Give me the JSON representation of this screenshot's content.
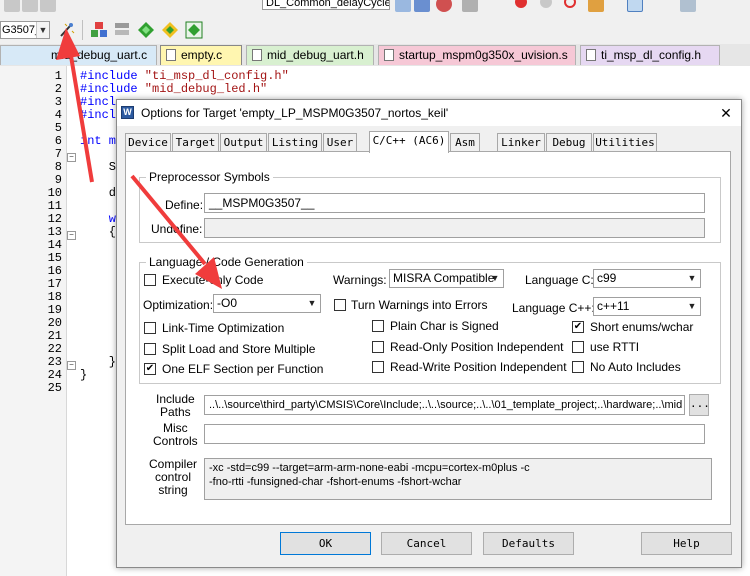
{
  "toolbar": {
    "target_combo_value": "G3507_",
    "function_combo_value": "DL_Common_delayCycles"
  },
  "file_tabs": [
    {
      "label": "mid_debug_uart.c",
      "color": "#d7e9f7"
    },
    {
      "label": "empty.c",
      "color": "#fff6b0"
    },
    {
      "label": "mid_debug_uart.h",
      "color": "#d8f0d0"
    },
    {
      "label": "startup_mspm0g350x_uvision.s",
      "color": "#f6c8d6"
    },
    {
      "label": "ti_msp_dl_config.h",
      "color": "#e6d8f2"
    }
  ],
  "editor": {
    "line_numbers": [
      "1",
      "2",
      "3",
      "4",
      "5",
      "6",
      "7",
      "8",
      "9",
      "10",
      "11",
      "12",
      "13",
      "14",
      "15",
      "16",
      "17",
      "18",
      "19",
      "20",
      "21",
      "22",
      "23",
      "24",
      "25"
    ],
    "code_lines": {
      "l1_kw": "#include",
      "l1_str": " \"ti_msp_dl_config.h\"",
      "l2_kw": "#include",
      "l2_str": " \"mid_debug_led.h\"",
      "l3": "#incl",
      "l4": "#incl",
      "l6": "int m",
      "l8": "    Sy",
      "l10": "    d",
      "l12": "    w",
      "l13": "    {",
      "l21": "    }",
      "l22": "}"
    }
  },
  "dialog": {
    "title": "Options for Target 'empty_LP_MSPM0G3507_nortos_keil'",
    "close_label": "✕",
    "tabs": [
      "Device",
      "Target",
      "Output",
      "Listing",
      "User",
      "C/C++ (AC6)",
      "Asm",
      "Linker",
      "Debug",
      "Utilities"
    ],
    "active_tab": "C/C++ (AC6)",
    "preprocessor": {
      "group_title": "Preprocessor Symbols",
      "define_label": "Define:",
      "define_value": "__MSPM0G3507__",
      "undefine_label": "Undefine:",
      "undefine_value": ""
    },
    "language": {
      "group_title": "Language / Code Generation",
      "execute_only_label": "Execute-only Code",
      "execute_only_checked": false,
      "warnings_label": "Warnings:",
      "warnings_value": "MISRA Compatible",
      "language_c_label": "Language C:",
      "language_c_value": "c99",
      "optimization_label": "Optimization:",
      "optimization_value": "-O0",
      "turn_warnings_label": "Turn Warnings into Errors",
      "turn_warnings_checked": false,
      "language_cpp_label": "Language C++:",
      "language_cpp_value": "c++11",
      "lto_label": "Link-Time Optimization",
      "lto_checked": false,
      "plain_char_label": "Plain Char is Signed",
      "plain_char_checked": false,
      "short_enums_label": "Short enums/wchar",
      "short_enums_checked": true,
      "split_load_label": "Split Load and Store Multiple",
      "split_load_checked": false,
      "ropi_label": "Read-Only Position Independent",
      "ropi_checked": false,
      "use_rtti_label": "use RTTI",
      "use_rtti_checked": false,
      "one_elf_label": "One ELF Section per Function",
      "one_elf_checked": true,
      "rwpi_label": "Read-Write Position Independent",
      "rwpi_checked": false,
      "no_auto_label": "No Auto Includes",
      "no_auto_checked": false,
      "check_mark": "✔"
    },
    "include_paths": {
      "label_line1": "Include",
      "label_line2": "Paths",
      "value": "..\\..\\source\\third_party\\CMSIS\\Core\\Include;..\\..\\source;..\\..\\01_template_project;..\\hardware;..\\mid",
      "browse_label": "..."
    },
    "misc_controls": {
      "label_line1": "Misc",
      "label_line2": "Controls",
      "value": ""
    },
    "compiler_control": {
      "label_line1": "Compiler",
      "label_line2": "control",
      "label_line3": "string",
      "line1": "-xc -std=c99 --target=arm-arm-none-eabi -mcpu=cortex-m0plus -c",
      "line2": "-fno-rtti -funsigned-char -fshort-enums -fshort-wchar"
    },
    "buttons": {
      "ok": "OK",
      "cancel": "Cancel",
      "defaults": "Defaults",
      "help": "Help"
    }
  },
  "colors": {
    "annotation_arrow": "#f03c3c",
    "keyword": "#0000ff",
    "string": "#a31515"
  }
}
